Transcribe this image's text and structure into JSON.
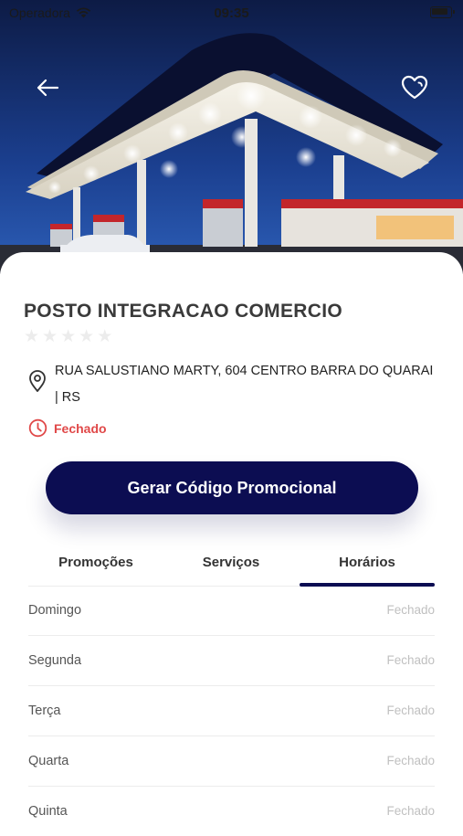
{
  "status_bar": {
    "carrier": "Operadora",
    "time": "09:35"
  },
  "header": {
    "back_icon": "back-arrow-icon",
    "favorite_icon": "heart-icon"
  },
  "station": {
    "name": "POSTO INTEGRACAO COMERCIO",
    "rating": 0,
    "rating_max": 5,
    "address": "RUA SALUSTIANO MARTY, 604 CENTRO BARRA DO QUARAI | RS",
    "status": "Fechado"
  },
  "promo_button": {
    "label": "Gerar Código Promocional"
  },
  "tabs": [
    {
      "label": "Promoções"
    },
    {
      "label": "Serviços"
    },
    {
      "label": "Horários"
    }
  ],
  "active_tab": "Horários",
  "hours": [
    {
      "day": "Domingo",
      "value": "Fechado"
    },
    {
      "day": "Segunda",
      "value": "Fechado"
    },
    {
      "day": "Terça",
      "value": "Fechado"
    },
    {
      "day": "Quarta",
      "value": "Fechado"
    },
    {
      "day": "Quinta",
      "value": "Fechado"
    }
  ],
  "colors": {
    "primary": "#0c0d52",
    "status_closed": "#e04848",
    "muted": "#c0c0c0"
  }
}
